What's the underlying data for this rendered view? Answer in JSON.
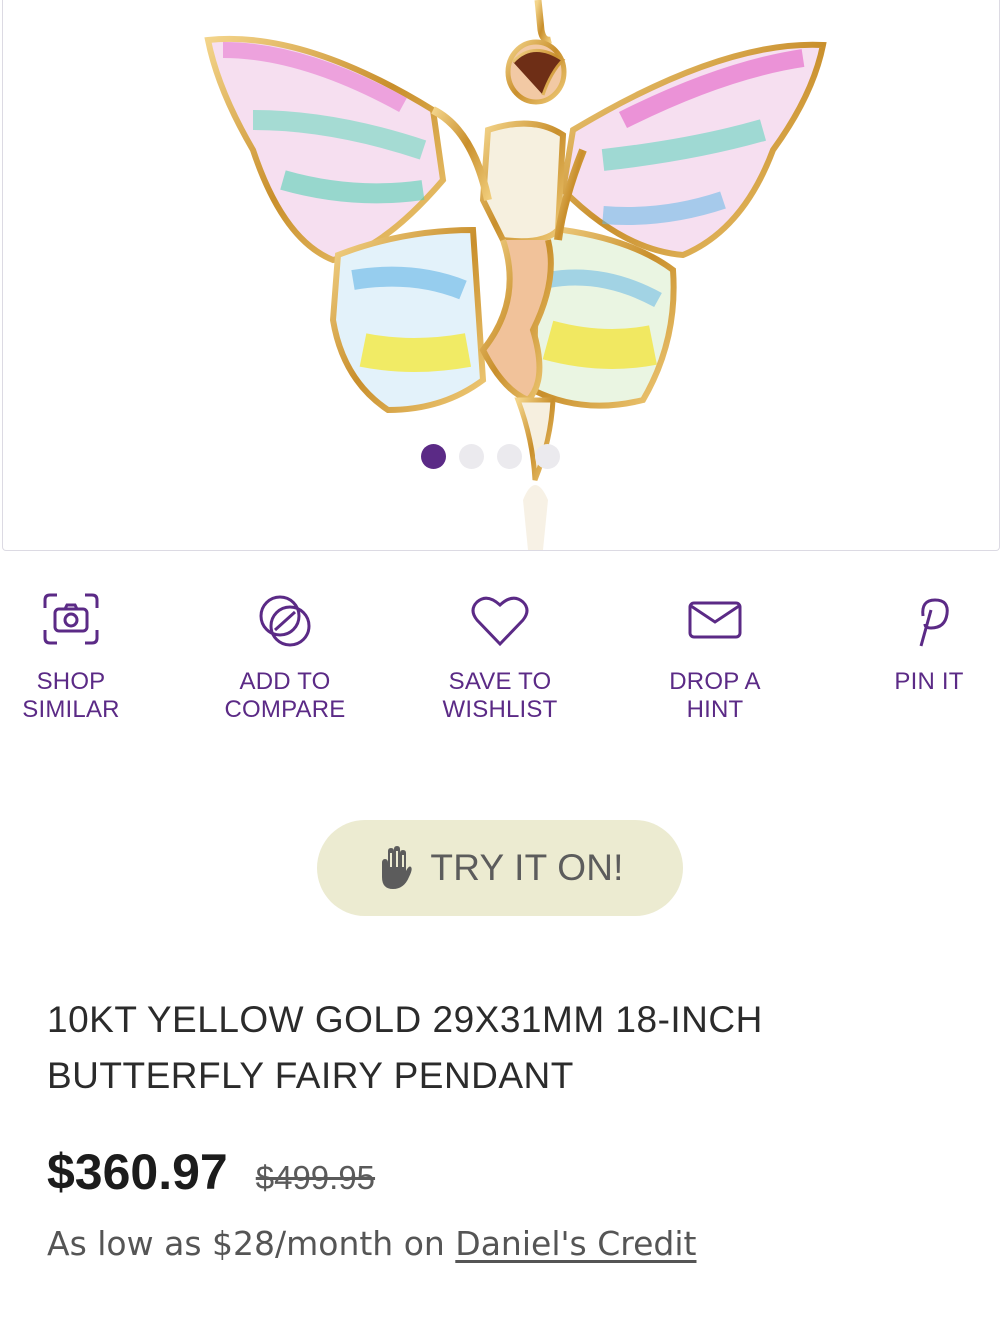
{
  "gallery": {
    "image_alt": "butterfly fairy pendant",
    "slides": 4,
    "active_slide": 1
  },
  "actions": [
    {
      "label": "SHOP\nSIMILAR",
      "icon": "camera-scan-icon"
    },
    {
      "label": "ADD TO\nCOMPARE",
      "icon": "compare-circles-icon"
    },
    {
      "label": "SAVE TO\nWISHLIST",
      "icon": "heart-icon"
    },
    {
      "label": "DROP A\nHINT",
      "icon": "envelope-icon"
    },
    {
      "label": "PIN IT",
      "icon": "pinterest-icon"
    }
  ],
  "try_on": {
    "label": "TRY IT ON!",
    "icon": "hand-icon"
  },
  "product": {
    "title": "10KT YELLOW GOLD 29X31MM 18-INCH BUTTERFLY FAIRY PENDANT",
    "price": "$360.97",
    "original_price": "$499.95",
    "credit_prefix": "As low as $28/month on ",
    "credit_link": "Daniel's Credit"
  },
  "colors": {
    "accent": "#5b2a86",
    "try_on_bg": "#ecebd1",
    "gold": "#d4a347"
  }
}
